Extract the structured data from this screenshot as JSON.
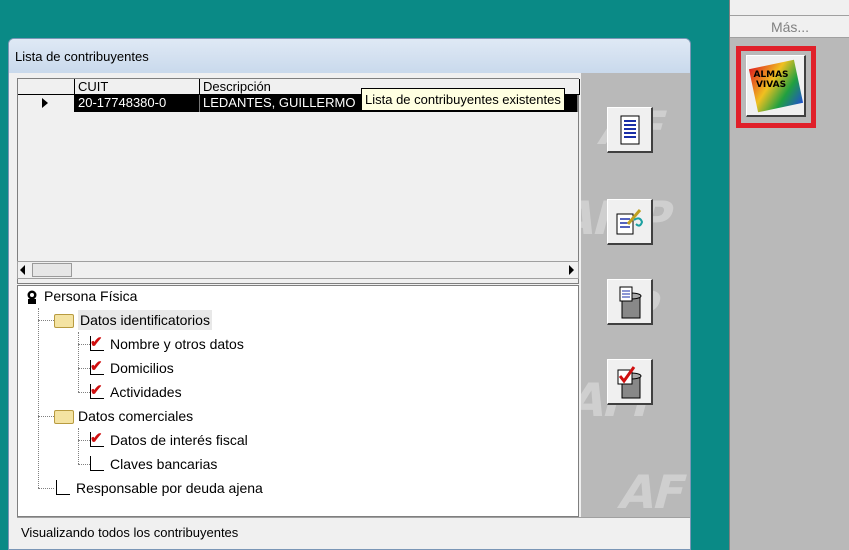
{
  "window": {
    "title": "Lista de contribuyentes"
  },
  "grid": {
    "columns": [
      "CUIT",
      "Descripción"
    ],
    "rows": [
      {
        "cuit": "20-17748380-0",
        "descripcion": "LEDANTES, GUILLERMO"
      }
    ]
  },
  "tooltip": "Lista de contribuyentes existentes",
  "tree": {
    "root": "Persona Física",
    "groups": [
      {
        "label": "Datos identificatorios",
        "items": [
          {
            "label": "Nombre y otros datos",
            "checked": true
          },
          {
            "label": "Domicilios",
            "checked": true
          },
          {
            "label": "Actividades",
            "checked": true
          }
        ]
      },
      {
        "label": "Datos comerciales",
        "items": [
          {
            "label": "Datos de interés fiscal",
            "checked": true
          },
          {
            "label": "Claves bancarias",
            "checked": false
          }
        ]
      }
    ],
    "extra": {
      "label": "Responsable por deuda ajena",
      "checked": false
    }
  },
  "status": "Visualizando todos los contribuyentes",
  "right_panel": {
    "mas_label": "Más...",
    "logo_text": "ALMAS VIVAS"
  },
  "buttons": [
    "list-icon",
    "edit-icon",
    "trash-list-icon",
    "trash-check-icon"
  ],
  "colors": {
    "desktop": "#0a8a86",
    "highlight": "#e0202a",
    "tooltip_bg": "#ffffe1"
  }
}
